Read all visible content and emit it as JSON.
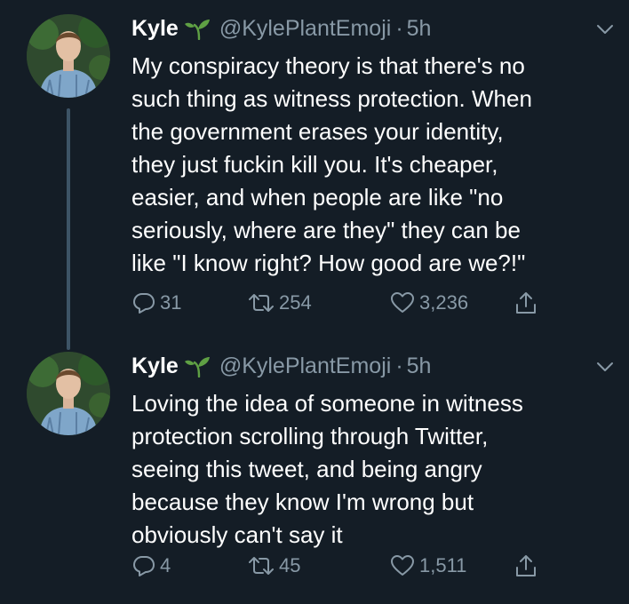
{
  "colors": {
    "background": "#141d26",
    "text": "#ffffff",
    "secondary": "#8899a6",
    "thread_line": "#3d5466",
    "sprout_green": "#5fa044"
  },
  "tweets": [
    {
      "name": "Kyle",
      "name_icon": "sprout-icon",
      "handle": "@KylePlantEmoji",
      "separator": "·",
      "time": "5h",
      "text_lines": [
        "My conspiracy theory is that there's no",
        "such thing as witness protection. When",
        "the government erases your identity,",
        "they just fuckin kill you. It's cheaper,",
        "easier, and when people are like \"no",
        "seriously, where are they\" they can be",
        "like \"I know right? How good are we?!\""
      ],
      "replies": "31",
      "retweets": "254",
      "likes": "3,236"
    },
    {
      "name": "Kyle",
      "name_icon": "sprout-icon",
      "handle": "@KylePlantEmoji",
      "separator": "·",
      "time": "5h",
      "text_lines": [
        "Loving the idea of someone in witness",
        "protection scrolling through Twitter,",
        "seeing this tweet, and being angry",
        "because they know I'm wrong but",
        "obviously can't say it"
      ],
      "replies": "4",
      "retweets": "45",
      "likes": "1,511"
    }
  ]
}
